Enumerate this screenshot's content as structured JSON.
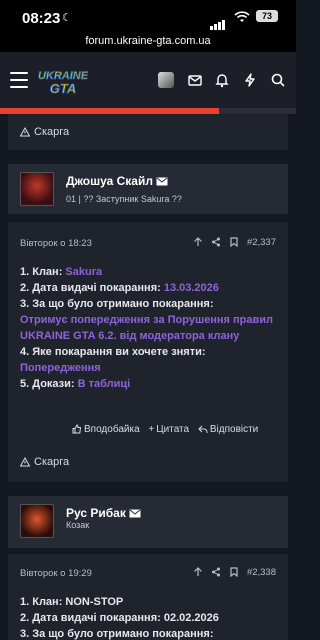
{
  "status": {
    "time": "08:23",
    "battery": "73"
  },
  "browser": {
    "url": "forum.ukraine-gta.com.ua"
  },
  "logo": {
    "line1": "UKRAINE",
    "line2": "GTA"
  },
  "colors": {
    "accent": "#e8402a",
    "highlight": "#8f63d9",
    "panel": "#1f232c"
  },
  "page_progress": 0.74,
  "posts": [
    {
      "report": "Скарга"
    },
    {
      "author": "Джошуа Скайл",
      "user_title": "01 | ?? Заступник Sakura ??",
      "date": "Вівторок о 18:23",
      "number": "#2,337",
      "lines": [
        {
          "label": "1. Клан: ",
          "value": "Sakura"
        },
        {
          "label": "2. Дата видачі покарання: ",
          "value": "13.03.2026"
        },
        {
          "label": "3. За що було отримано покарання:",
          "value": ""
        },
        {
          "label": "",
          "value": "Отримує попередження за Порушення правил UKRAINE GTA 6.2. від модератора клану"
        },
        {
          "label": "4. Яке покарання ви хочете зняти:",
          "value": ""
        },
        {
          "label": "",
          "value": "Попередження"
        },
        {
          "label": "5. Докази: ",
          "value": "В таблиці"
        }
      ],
      "actions": {
        "like": "Вподобайка",
        "quote": "Цитата",
        "reply": "Відповісти"
      },
      "report": "Скарга"
    },
    {
      "author": "Рус Рибак",
      "user_title": "Козак",
      "date": "Вівторок о 19:29",
      "number": "#2,338",
      "lines": [
        {
          "label": "1. Клан: NON-STOP",
          "value": ""
        },
        {
          "label": "2. Дата видачі покарання: 02.02.2026",
          "value": ""
        },
        {
          "label": "3. За що було отримано покарання:",
          "value": ""
        }
      ]
    }
  ]
}
